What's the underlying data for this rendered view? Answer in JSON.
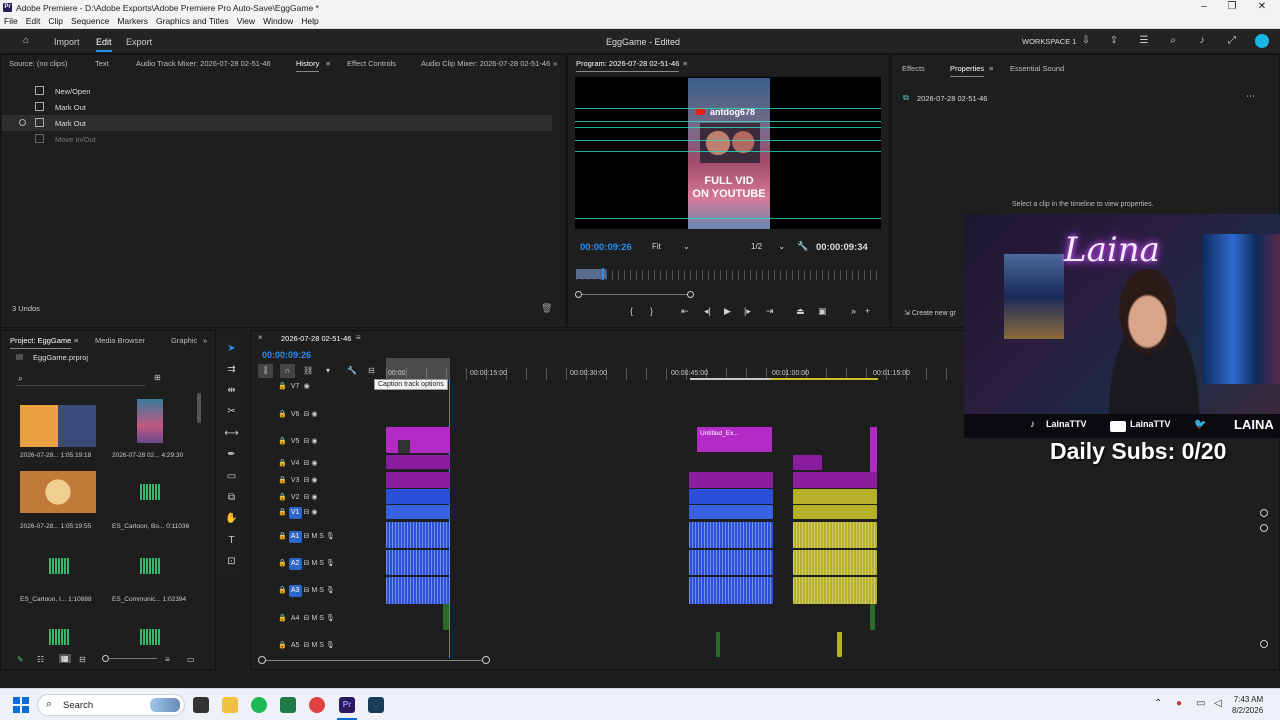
{
  "window": {
    "title": "Adobe Premiere - D:\\Adobe Exports\\Adobe Premiere Pro Auto-Save\\EggGame *",
    "app_icon_letters": "Pr"
  },
  "menu": [
    "File",
    "Edit",
    "Clip",
    "Sequence",
    "Markers",
    "Graphics and Titles",
    "View",
    "Window",
    "Help"
  ],
  "workspace": {
    "nav": [
      "Import",
      "Edit",
      "Export"
    ],
    "active_nav": "Edit",
    "project_title": "EggGame - Edited",
    "workspace_name": "WORKSPACE 1"
  },
  "top_left_panel": {
    "tabs": [
      "Source: (no clips)",
      "Text",
      "Audio Track Mixer: 2026-07-28 02-51-46",
      "History",
      "Effect Controls",
      "Audio Clip Mixer: 2026-07-28 02-51-46"
    ],
    "active_tab": "History",
    "history": [
      {
        "label": "New/Open",
        "selected": false,
        "dimmed": false
      },
      {
        "label": "Mark Out",
        "selected": false,
        "dimmed": false
      },
      {
        "label": "Mark Out",
        "selected": true,
        "dimmed": false
      },
      {
        "label": "Move In/Out",
        "selected": false,
        "dimmed": true
      }
    ],
    "undo_count": "3 Undos"
  },
  "program_monitor": {
    "tab": "Program: 2026-07-28 02-51-46",
    "overlay_handle": "antdog678",
    "overlay_line1": "FULL VID",
    "overlay_line2": "ON YOUTUBE",
    "current_timecode": "00:00:09:26",
    "fit": "Fit",
    "resolution": "1/2",
    "duration": "00:00:09:34"
  },
  "properties_panel": {
    "tabs": [
      "Effects",
      "Properties",
      "Essential Sound"
    ],
    "active_tab": "Properties",
    "sequence_name": "2026-07-28 02-51-46",
    "hint": "Select a clip in the timeline to view properties.",
    "create_button": "Create new gr"
  },
  "project_panel": {
    "tabs": [
      "Project: EggGame",
      "Media Browser",
      "Graphic"
    ],
    "project_file": "EggGame.prproj",
    "items": [
      {
        "name": "2026-07-28...",
        "duration": "1:05:19:18",
        "kind": "video"
      },
      {
        "name": "2026-07-28 02...",
        "duration": "4:29:30",
        "kind": "video"
      },
      {
        "name": "2026-07-28...",
        "duration": "1:05:19:55",
        "kind": "video"
      },
      {
        "name": "ES_Cartoon, Bo...",
        "duration": "0:11036",
        "kind": "audio"
      },
      {
        "name": "ES_Cartoon, I...",
        "duration": "1:10888",
        "kind": "audio"
      },
      {
        "name": "ES_Communic...",
        "duration": "1:02394",
        "kind": "audio"
      }
    ]
  },
  "timeline": {
    "tab": "2026-07-28 02-51-46",
    "timecode": "00:00:09:26",
    "tooltip": "Caption track options",
    "ruler": [
      "00:00",
      "00:00:15:00",
      "00:00:30:00",
      "00:00:45:00",
      "00:01:00:00",
      "00:01:15:00"
    ],
    "video_tracks": [
      "V7",
      "V6",
      "V5",
      "V4",
      "V3",
      "V2",
      "V1"
    ],
    "audio_tracks": [
      "A1",
      "A2",
      "A3",
      "A4",
      "A5"
    ],
    "clip_label": "Untitled_Ex...",
    "track_controls": {
      "mute": "M",
      "solo": "S"
    }
  },
  "stream_overlay": {
    "neon_name": "Laina",
    "socials": [
      "LainaTTV",
      "LainaTTV",
      "LAINA"
    ],
    "daily_subs": "Daily Subs: 0/20"
  },
  "taskbar": {
    "search_label": "Search",
    "time": "7:43 AM",
    "date": "8/2/2026"
  },
  "colors": {
    "accent": "#2d8ceb",
    "clip_blue": "#2b4fd6",
    "clip_magenta": "#8a1c9e",
    "clip_yellow": "#b7b02a",
    "guides": "#2ee0c0"
  }
}
